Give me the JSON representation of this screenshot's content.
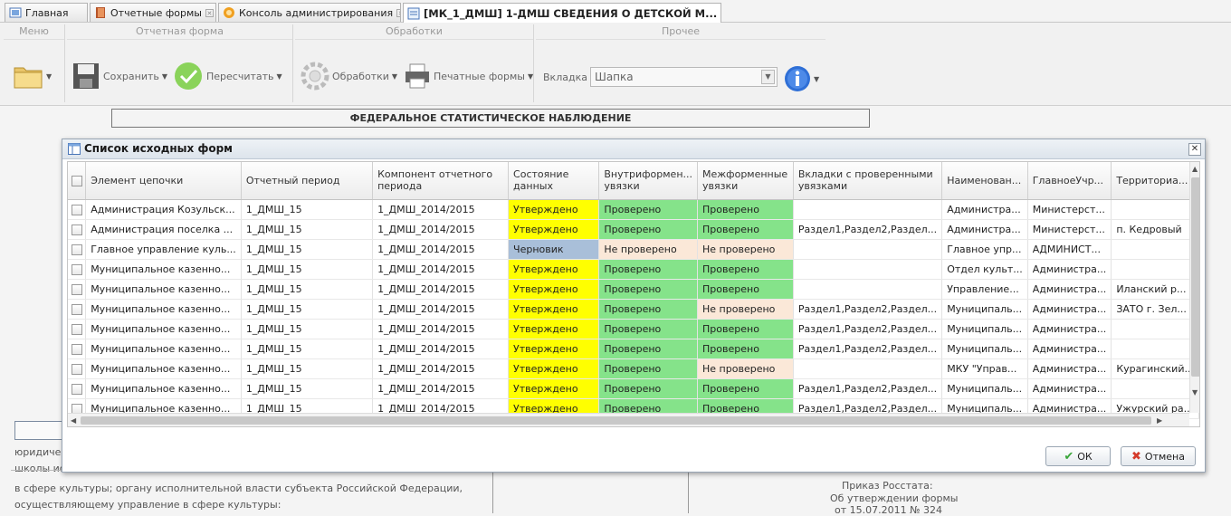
{
  "tabs": [
    {
      "label": "Главная",
      "closable": false
    },
    {
      "label": "Отчетные формы",
      "closable": true
    },
    {
      "label": "Консоль администрирования",
      "closable": true
    },
    {
      "label": "[МК_1_ДМШ] 1-ДМШ СВЕДЕНИЯ О ДЕТСКОЙ М...",
      "closable": true
    }
  ],
  "ribbon": {
    "groups": {
      "menu": "Меню",
      "form": "Отчетная форма",
      "processing": "Обработки",
      "other": "Прочее"
    },
    "save": "Сохранить",
    "recalc": "Пересчитать",
    "processing_btn": "Обработки",
    "print_forms": "Печатные формы",
    "tab_label": "Вкладка",
    "tab_value": "Шапка"
  },
  "doc": {
    "header": "ФЕДЕРАЛЬНОЕ СТАТИСТИЧЕСКОЕ НАБЛЮДЕНИЕ",
    "left1": "юридичес",
    "left2": "школы ис",
    "line1": "в сфере культуры; органу исполнительной власти субъекта Российской Федерации,",
    "line2": "осуществляющему управление в сфере культуры:",
    "order1": "Приказ Росстата:",
    "order2": "Об утверждении формы",
    "order3": "от 15.07.2011 № 324"
  },
  "dialog": {
    "title": "Список исходных форм",
    "ok": "ОК",
    "cancel": "Отмена",
    "columns": [
      "Элемент цепочки",
      "Отчетный период",
      "Компонент отчетного периода",
      "Состояние данных",
      "Внутриформен... увязки",
      "Межформенные увязки",
      "Вкладки с проверенными увязками",
      "Наименован...",
      "ГлавноеУчр...",
      "Территориа..."
    ],
    "rows": [
      [
        "Администрация Козульск...",
        "1_ДМШ_15",
        "1_ДМШ_2014/2015",
        "Утверждено",
        "Проверено",
        "Проверено",
        "",
        "Администра...",
        "Министерст...",
        ""
      ],
      [
        "Администрация поселка ...",
        "1_ДМШ_15",
        "1_ДМШ_2014/2015",
        "Утверждено",
        "Проверено",
        "Проверено",
        "Раздел1,Раздел2,Раздел...",
        "Администра...",
        "Министерст...",
        "п. Кедровый"
      ],
      [
        "Главное управление куль...",
        "1_ДМШ_15",
        "1_ДМШ_2014/2015",
        "Черновик",
        "Не проверено",
        "Не проверено",
        "",
        "Главное упр...",
        "АДМИНИСТ...",
        ""
      ],
      [
        "Муниципальное казенно...",
        "1_ДМШ_15",
        "1_ДМШ_2014/2015",
        "Утверждено",
        "Проверено",
        "Проверено",
        "",
        "Отдел культ...",
        "Администра...",
        ""
      ],
      [
        "Муниципальное казенно...",
        "1_ДМШ_15",
        "1_ДМШ_2014/2015",
        "Утверждено",
        "Проверено",
        "Проверено",
        "",
        "Управление...",
        "Администра...",
        "Иланский р..."
      ],
      [
        "Муниципальное казенно...",
        "1_ДМШ_15",
        "1_ДМШ_2014/2015",
        "Утверждено",
        "Проверено",
        "Не проверено",
        "Раздел1,Раздел2,Раздел...",
        "Муниципаль...",
        "Администра...",
        "ЗАТО г. Зел..."
      ],
      [
        "Муниципальное казенно...",
        "1_ДМШ_15",
        "1_ДМШ_2014/2015",
        "Утверждено",
        "Проверено",
        "Проверено",
        "Раздел1,Раздел2,Раздел...",
        "Муниципаль...",
        "Администра...",
        ""
      ],
      [
        "Муниципальное казенно...",
        "1_ДМШ_15",
        "1_ДМШ_2014/2015",
        "Утверждено",
        "Проверено",
        "Проверено",
        "Раздел1,Раздел2,Раздел...",
        "Муниципаль...",
        "Администра...",
        ""
      ],
      [
        "Муниципальное казенно...",
        "1_ДМШ_15",
        "1_ДМШ_2014/2015",
        "Утверждено",
        "Проверено",
        "Не проверено",
        "",
        "МКУ \"Управ...",
        "Администра...",
        "Курагинский..."
      ],
      [
        "Муниципальное казенно...",
        "1_ДМШ_15",
        "1_ДМШ_2014/2015",
        "Утверждено",
        "Проверено",
        "Проверено",
        "Раздел1,Раздел2,Раздел...",
        "Муниципаль...",
        "Администра...",
        ""
      ],
      [
        "Муниципальное казенно...",
        "1_ДМШ_15",
        "1_ДМШ_2014/2015",
        "Утверждено",
        "Проверено",
        "Проверено",
        "Раздел1,Раздел2,Раздел...",
        "Муниципаль...",
        "Администра...",
        "Ужурский ра..."
      ]
    ]
  },
  "colors": {
    "approved": "#ffff00",
    "draft": "#a9bfd9",
    "checked": "#85e38a",
    "not_checked": "#fbe8d8"
  }
}
